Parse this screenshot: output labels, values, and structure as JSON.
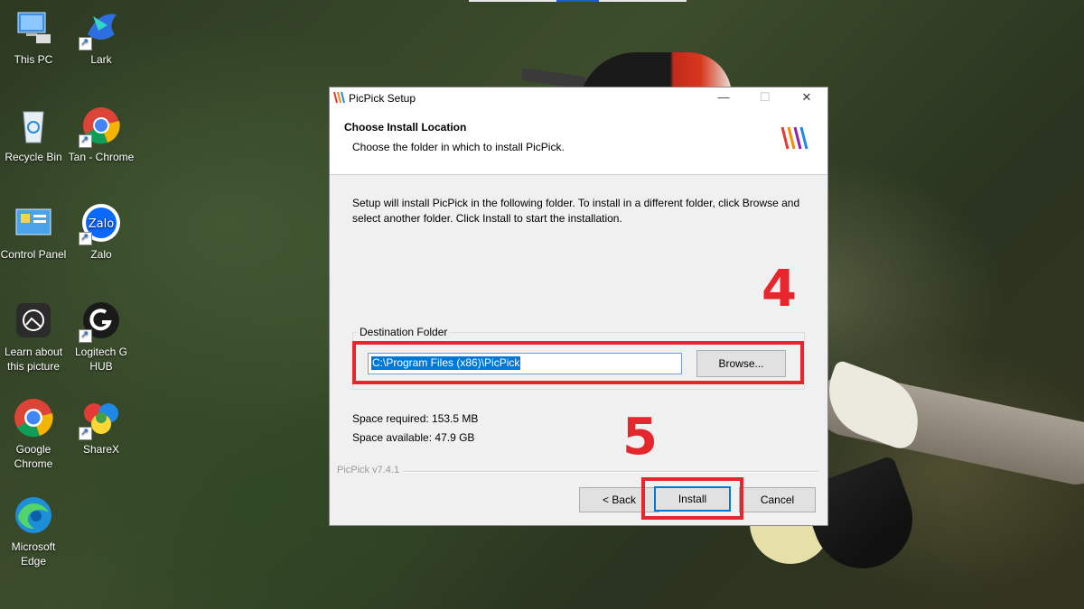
{
  "desktop": {
    "icons": [
      {
        "label": "This PC",
        "icon": "computer-icon"
      },
      {
        "label": "Lark",
        "icon": "lark-icon"
      },
      {
        "label": "Recycle Bin",
        "icon": "recycle-bin-icon"
      },
      {
        "label": "Tan - Chrome",
        "icon": "chrome-icon"
      },
      {
        "label": "Control Panel",
        "icon": "control-panel-icon"
      },
      {
        "label": "Zalo",
        "icon": "zalo-icon"
      },
      {
        "label": "Learn about this picture",
        "icon": "learn-picture-icon"
      },
      {
        "label": "Logitech G HUB",
        "icon": "logitech-icon"
      },
      {
        "label": "Google Chrome",
        "icon": "chrome-icon"
      },
      {
        "label": "ShareX",
        "icon": "sharex-icon"
      },
      {
        "label": "Microsoft Edge",
        "icon": "edge-icon"
      }
    ]
  },
  "dialog": {
    "title": "PicPick Setup",
    "minimize": "—",
    "maximize": "☐",
    "close": "✕",
    "header_title": "Choose Install Location",
    "header_subtitle": "Choose the folder in which to install PicPick.",
    "description": "Setup will install PicPick in the following folder. To install in a different folder, click Browse and select another folder. Click Install to start the installation.",
    "destination_legend": "Destination Folder",
    "destination_path": "C:\\Program Files (x86)\\PicPick",
    "browse_label": "Browse...",
    "space_required": "Space required: 153.5 MB",
    "space_available": "Space available: 47.9 GB",
    "version": "PicPick v7.4.1",
    "back_label": "< Back",
    "install_label": "Install",
    "cancel_label": "Cancel"
  },
  "annotations": {
    "step4": "4",
    "step5": "5",
    "color": "#e5262d"
  }
}
